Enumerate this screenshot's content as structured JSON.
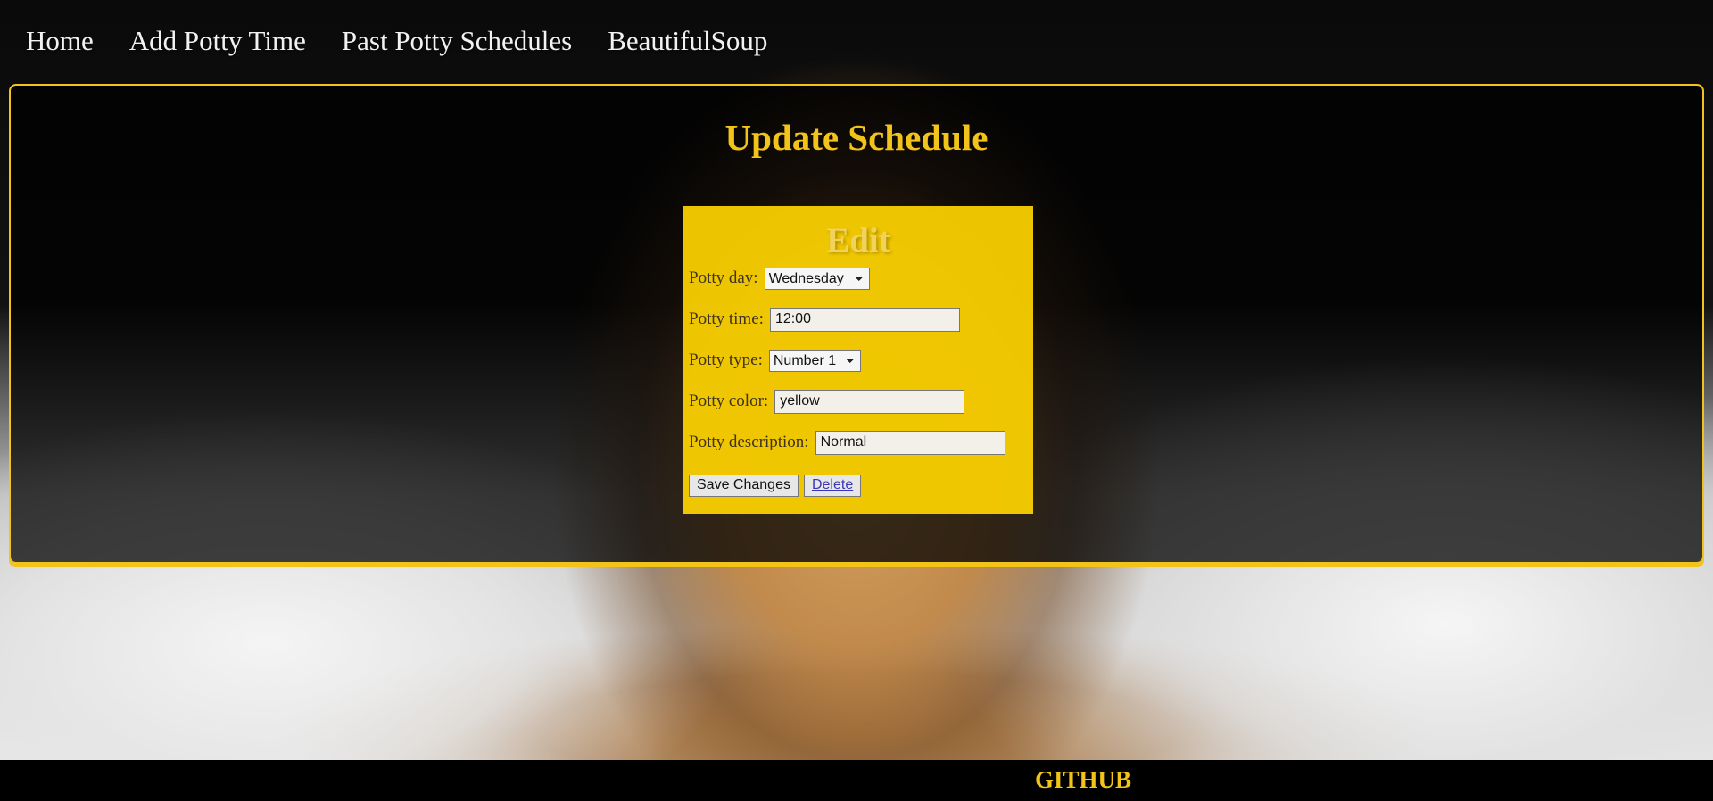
{
  "nav": {
    "items": [
      {
        "label": "Home"
      },
      {
        "label": "Add Potty Time"
      },
      {
        "label": "Past Potty Schedules"
      },
      {
        "label": "BeautifulSoup"
      }
    ]
  },
  "main": {
    "title": "Update Schedule",
    "edit_card": {
      "title": "Edit",
      "fields": {
        "potty_day": {
          "label": "Potty day:",
          "selected": "Wednesday"
        },
        "potty_time": {
          "label": "Potty time:",
          "value": "12:00"
        },
        "potty_type": {
          "label": "Potty type:",
          "selected": "Number 1"
        },
        "potty_color": {
          "label": "Potty color:",
          "value": "yellow"
        },
        "potty_description": {
          "label": "Potty description:",
          "value": "Normal"
        }
      },
      "actions": {
        "save_label": "Save Changes",
        "delete_label": "Delete"
      }
    }
  },
  "footer": {
    "github_label": "GITHUB"
  },
  "colors": {
    "accent": "#f2c318",
    "card_background": "#ffd500",
    "panel_background": "#000000"
  }
}
